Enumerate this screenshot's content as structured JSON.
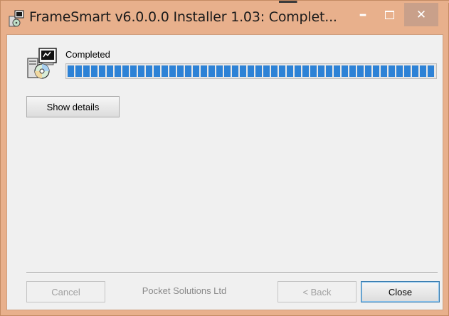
{
  "window": {
    "title": "FrameSmart v6.0.0.0 Installer 1.03: Complet...",
    "controls": {
      "minimize": "–",
      "close": "✕"
    }
  },
  "installer": {
    "status": "Completed",
    "progress_percent": 100,
    "show_details_label": "Show details",
    "branding": "Pocket Solutions Ltd"
  },
  "footer": {
    "cancel_label": "Cancel",
    "back_label": "< Back",
    "close_label": "Close"
  },
  "icons": {
    "app": "installer-app-icon",
    "installer": "installer-cd-computer-icon"
  },
  "colors": {
    "title_bar": "#e8b08c",
    "progress": "#2d82d6",
    "client_bg": "#f0f0f0"
  }
}
